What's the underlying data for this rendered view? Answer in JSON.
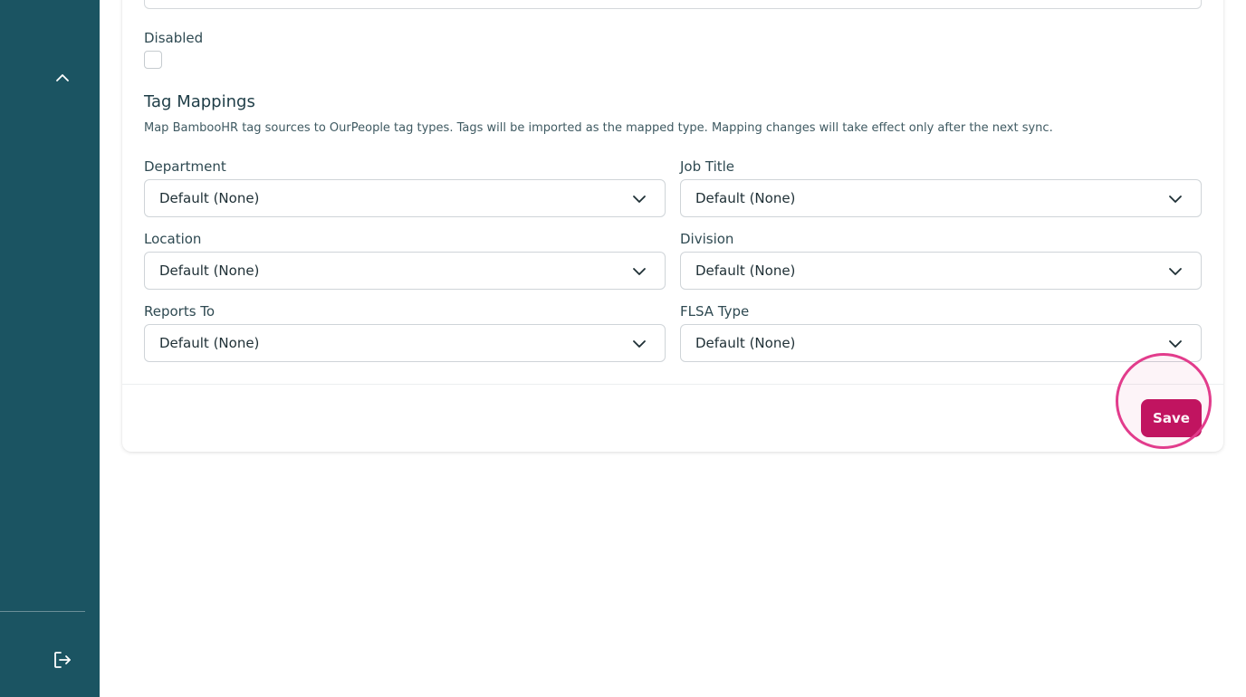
{
  "sidebar": {
    "collapse_icon": "chevron-up-icon",
    "logout_icon": "logout-icon"
  },
  "form": {
    "disabled_label": "Disabled",
    "disabled_checked": false
  },
  "tag_mappings": {
    "title": "Tag Mappings",
    "description": "Map BambooHR tag sources to OurPeople tag types. Tags will be imported as the mapped type. Mapping changes will take effect only after the next sync.",
    "fields": [
      {
        "label": "Department",
        "value": "Default (None)"
      },
      {
        "label": "Job Title",
        "value": "Default (None)"
      },
      {
        "label": "Location",
        "value": "Default (None)"
      },
      {
        "label": "Division",
        "value": "Default (None)"
      },
      {
        "label": "Reports To",
        "value": "Default (None)"
      },
      {
        "label": "FLSA Type",
        "value": "Default (None)"
      }
    ]
  },
  "footer": {
    "save_label": "Save"
  },
  "colors": {
    "sidebar": "#1b5462",
    "primary": "#c0125e",
    "highlight": "#e23c8c"
  }
}
